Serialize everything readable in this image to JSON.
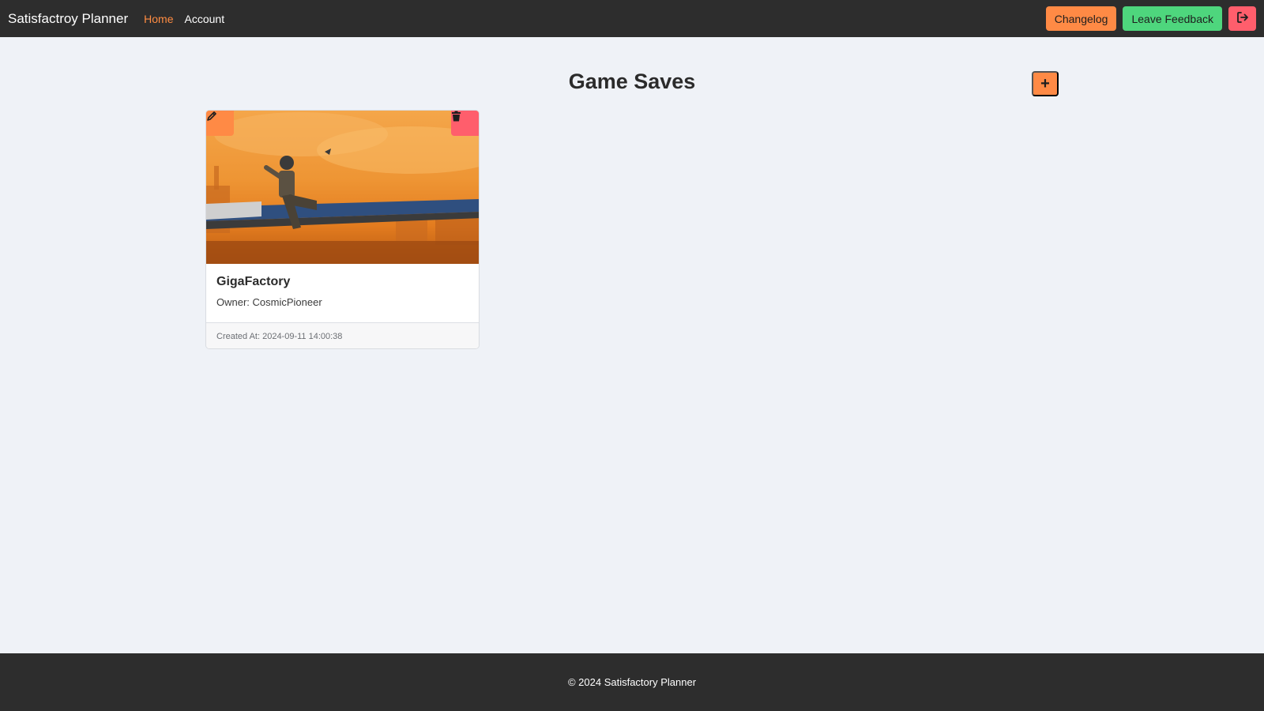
{
  "navbar": {
    "brand": "Satisfactroy Planner",
    "links": [
      {
        "label": "Home",
        "active": true
      },
      {
        "label": "Account",
        "active": false
      }
    ],
    "changelog_label": "Changelog",
    "feedback_label": "Leave Feedback",
    "logout_icon": "logout-icon"
  },
  "main": {
    "title": "Game Saves",
    "add_button_label": "+"
  },
  "saves": [
    {
      "name": "GigaFactory",
      "owner": "Owner: CosmicPioneer",
      "created": "Created At: 2024-09-11 14:00:38",
      "edit_icon": "pencil-icon",
      "delete_icon": "trash-icon"
    }
  ],
  "footer": {
    "text": "© 2024 Satisfactory Planner"
  },
  "colors": {
    "navbar_bg": "#2d2d2d",
    "accent_orange": "#ff8a45",
    "accent_green": "#4ed67d",
    "accent_red": "#ff5e6c",
    "page_bg": "#eff2f7"
  }
}
